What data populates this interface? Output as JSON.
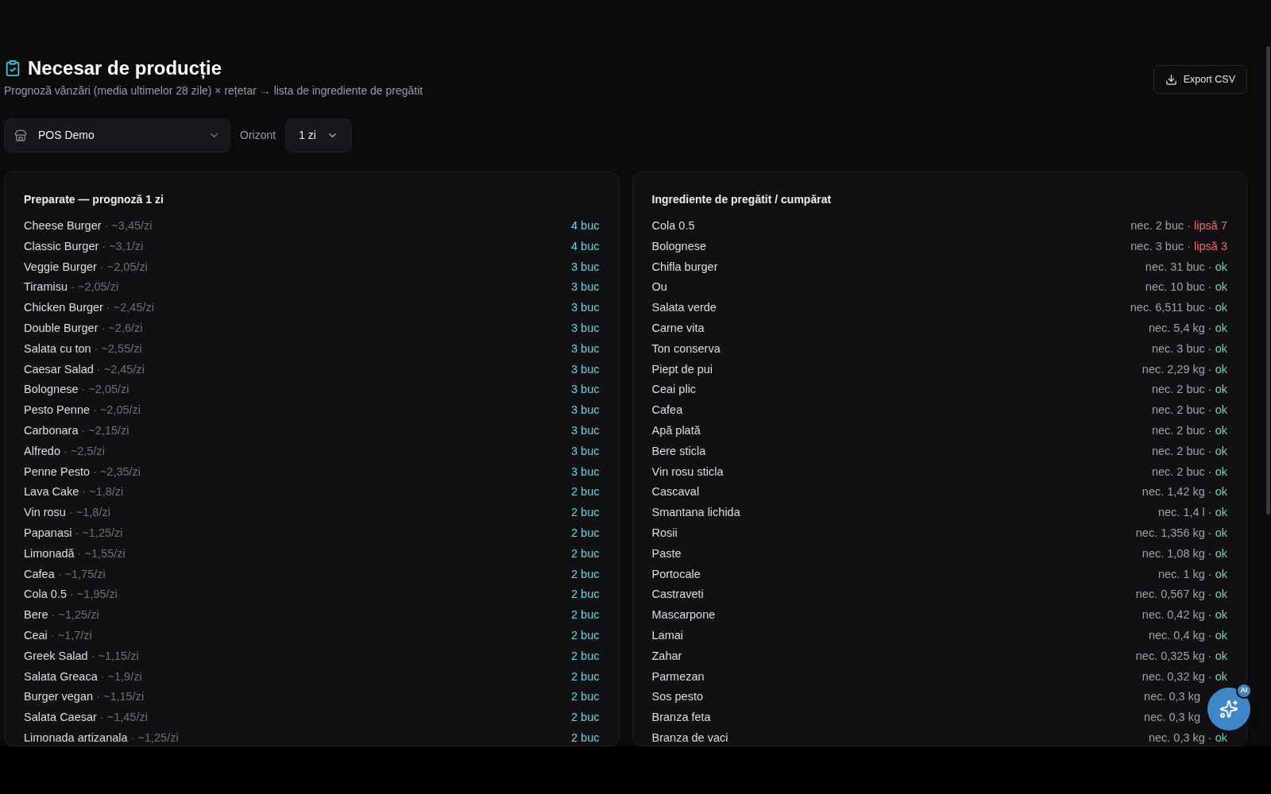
{
  "header": {
    "title": "Necesar de producție",
    "subtitle": "Prognoză vânzări (media ultimelor 28 zile) × rețetar → lista de ingrediente de pregătit",
    "export_button": "Export CSV"
  },
  "filters": {
    "location": "POS Demo",
    "horizon_label": "Orizont",
    "horizon": "1 zi"
  },
  "dishes": {
    "title": "Preparate — prognoză 1 zi",
    "rows": [
      {
        "name": "Cheese Burger",
        "rate": "· ~3,45/zi",
        "qty": "4 buc"
      },
      {
        "name": "Classic Burger",
        "rate": "· ~3,1/zi",
        "qty": "4 buc"
      },
      {
        "name": "Veggie Burger",
        "rate": "· ~2,05/zi",
        "qty": "3 buc"
      },
      {
        "name": "Tiramisu",
        "rate": "· ~2,05/zi",
        "qty": "3 buc"
      },
      {
        "name": "Chicken Burger",
        "rate": "· ~2,45/zi",
        "qty": "3 buc"
      },
      {
        "name": "Double Burger",
        "rate": "· ~2,6/zi",
        "qty": "3 buc"
      },
      {
        "name": "Salata cu ton",
        "rate": "· ~2,55/zi",
        "qty": "3 buc"
      },
      {
        "name": "Caesar Salad",
        "rate": "· ~2,45/zi",
        "qty": "3 buc"
      },
      {
        "name": "Bolognese",
        "rate": "· ~2,05/zi",
        "qty": "3 buc"
      },
      {
        "name": "Pesto Penne",
        "rate": "· ~2,05/zi",
        "qty": "3 buc"
      },
      {
        "name": "Carbonara",
        "rate": "· ~2,15/zi",
        "qty": "3 buc"
      },
      {
        "name": "Alfredo",
        "rate": "· ~2,5/zi",
        "qty": "3 buc"
      },
      {
        "name": "Penne Pesto",
        "rate": "· ~2,35/zi",
        "qty": "3 buc"
      },
      {
        "name": "Lava Cake",
        "rate": "· ~1,8/zi",
        "qty": "2 buc"
      },
      {
        "name": "Vin rosu",
        "rate": "· ~1,8/zi",
        "qty": "2 buc"
      },
      {
        "name": "Papanasi",
        "rate": "· ~1,25/zi",
        "qty": "2 buc"
      },
      {
        "name": "Limonadă",
        "rate": "· ~1,55/zi",
        "qty": "2 buc"
      },
      {
        "name": "Cafea",
        "rate": "· ~1,75/zi",
        "qty": "2 buc"
      },
      {
        "name": "Cola 0.5",
        "rate": "· ~1,95/zi",
        "qty": "2 buc"
      },
      {
        "name": "Bere",
        "rate": "· ~1,25/zi",
        "qty": "2 buc"
      },
      {
        "name": "Ceai",
        "rate": "· ~1,7/zi",
        "qty": "2 buc"
      },
      {
        "name": "Greek Salad",
        "rate": "· ~1,15/zi",
        "qty": "2 buc"
      },
      {
        "name": "Salata Greaca",
        "rate": "· ~1,9/zi",
        "qty": "2 buc"
      },
      {
        "name": "Burger vegan",
        "rate": "· ~1,15/zi",
        "qty": "2 buc"
      },
      {
        "name": "Salata Caesar",
        "rate": "· ~1,45/zi",
        "qty": "2 buc"
      },
      {
        "name": "Limonada artizanala",
        "rate": "· ~1,25/zi",
        "qty": "2 buc"
      }
    ]
  },
  "ingredients": {
    "title": "Ingrediente de pregătit / cumpărat",
    "rows": [
      {
        "name": "Cola 0.5",
        "need": "nec. 2 buc",
        "status": "· lipsă 7",
        "kind": "short"
      },
      {
        "name": "Bolognese",
        "need": "nec. 3 buc",
        "status": "· lipsă 3",
        "kind": "short"
      },
      {
        "name": "Chifla burger",
        "need": "nec. 31 buc",
        "status": "· ok",
        "kind": "ok"
      },
      {
        "name": "Ou",
        "need": "nec. 10 buc",
        "status": "· ok",
        "kind": "ok"
      },
      {
        "name": "Salata verde",
        "need": "nec. 6,511 buc",
        "status": "· ok",
        "kind": "ok"
      },
      {
        "name": "Carne vita",
        "need": "nec. 5,4 kg",
        "status": "· ok",
        "kind": "ok"
      },
      {
        "name": "Ton conserva",
        "need": "nec. 3 buc",
        "status": "· ok",
        "kind": "ok"
      },
      {
        "name": "Piept de pui",
        "need": "nec. 2,29 kg",
        "status": "· ok",
        "kind": "ok"
      },
      {
        "name": "Ceai plic",
        "need": "nec. 2 buc",
        "status": "· ok",
        "kind": "ok"
      },
      {
        "name": "Cafea",
        "need": "nec. 2 buc",
        "status": "· ok",
        "kind": "ok"
      },
      {
        "name": "Apă plată",
        "need": "nec. 2 buc",
        "status": "· ok",
        "kind": "ok"
      },
      {
        "name": "Bere sticla",
        "need": "nec. 2 buc",
        "status": "· ok",
        "kind": "ok"
      },
      {
        "name": "Vin rosu sticla",
        "need": "nec. 2 buc",
        "status": "· ok",
        "kind": "ok"
      },
      {
        "name": "Cascaval",
        "need": "nec. 1,42 kg",
        "status": "· ok",
        "kind": "ok"
      },
      {
        "name": "Smantana lichida",
        "need": "nec. 1,4 l",
        "status": "· ok",
        "kind": "ok"
      },
      {
        "name": "Rosii",
        "need": "nec. 1,356 kg",
        "status": "· ok",
        "kind": "ok"
      },
      {
        "name": "Paste",
        "need": "nec. 1,08 kg",
        "status": "· ok",
        "kind": "ok"
      },
      {
        "name": "Portocale",
        "need": "nec. 1 kg",
        "status": "· ok",
        "kind": "ok"
      },
      {
        "name": "Castraveti",
        "need": "nec. 0,567 kg",
        "status": "· ok",
        "kind": "ok"
      },
      {
        "name": "Mascarpone",
        "need": "nec. 0,42 kg",
        "status": "· ok",
        "kind": "ok"
      },
      {
        "name": "Lamai",
        "need": "nec. 0,4 kg",
        "status": "· ok",
        "kind": "ok"
      },
      {
        "name": "Zahar",
        "need": "nec. 0,325 kg",
        "status": "· ok",
        "kind": "ok"
      },
      {
        "name": "Parmezan",
        "need": "nec. 0,32 kg",
        "status": "· ok",
        "kind": "ok"
      },
      {
        "name": "Sos pesto",
        "need": "nec. 0,3 kg"
      },
      {
        "name": "Branza feta",
        "need": "nec. 0,3 kg"
      },
      {
        "name": "Branza de vaci",
        "need": "nec. 0,3 kg",
        "status": "· ok",
        "kind": "ok"
      }
    ]
  },
  "assistant_button": {
    "badge": "AI"
  }
}
